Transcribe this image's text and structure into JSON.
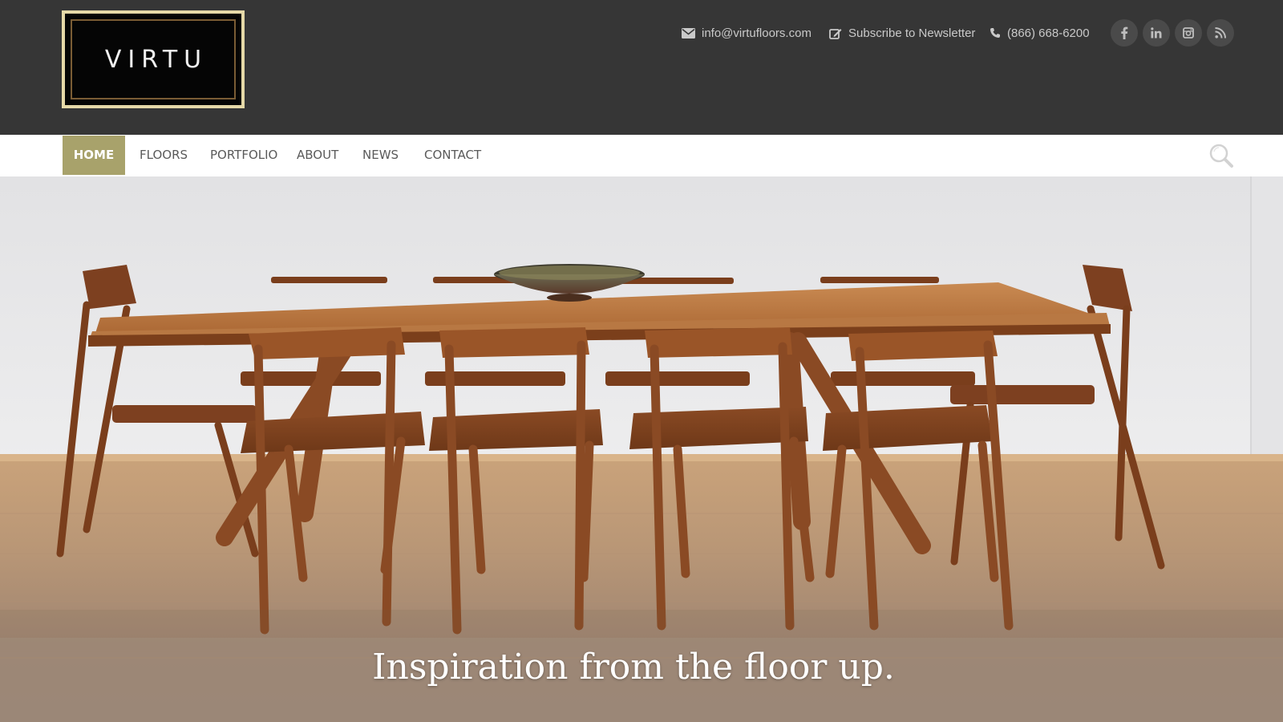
{
  "brand": {
    "logo_text": "VIRTU",
    "frame_color": "#7a5c34",
    "border_color": "#e6d9a8"
  },
  "header": {
    "email": "info@virtufloors.com",
    "newsletter": "Subscribe to Newsletter",
    "phone": "(866) 668-6200",
    "social": [
      {
        "icon": "facebook-icon"
      },
      {
        "icon": "linkedin-icon"
      },
      {
        "icon": "instagram-icon"
      },
      {
        "icon": "rss-icon"
      }
    ]
  },
  "nav": {
    "items": [
      {
        "label": "HOME",
        "active": true
      },
      {
        "label": "FLOORS"
      },
      {
        "label": "PORTFOLIO"
      },
      {
        "label": "ABOUT"
      },
      {
        "label": "NEWS"
      },
      {
        "label": "CONTACT"
      }
    ],
    "search_icon": "search-icon"
  },
  "hero": {
    "tagline": "Inspiration from the floor up.",
    "image": "dining-room-photo"
  },
  "colors": {
    "header_bg": "#363636",
    "accent": "#a8a26b",
    "nav_text": "#5a5a5a"
  }
}
